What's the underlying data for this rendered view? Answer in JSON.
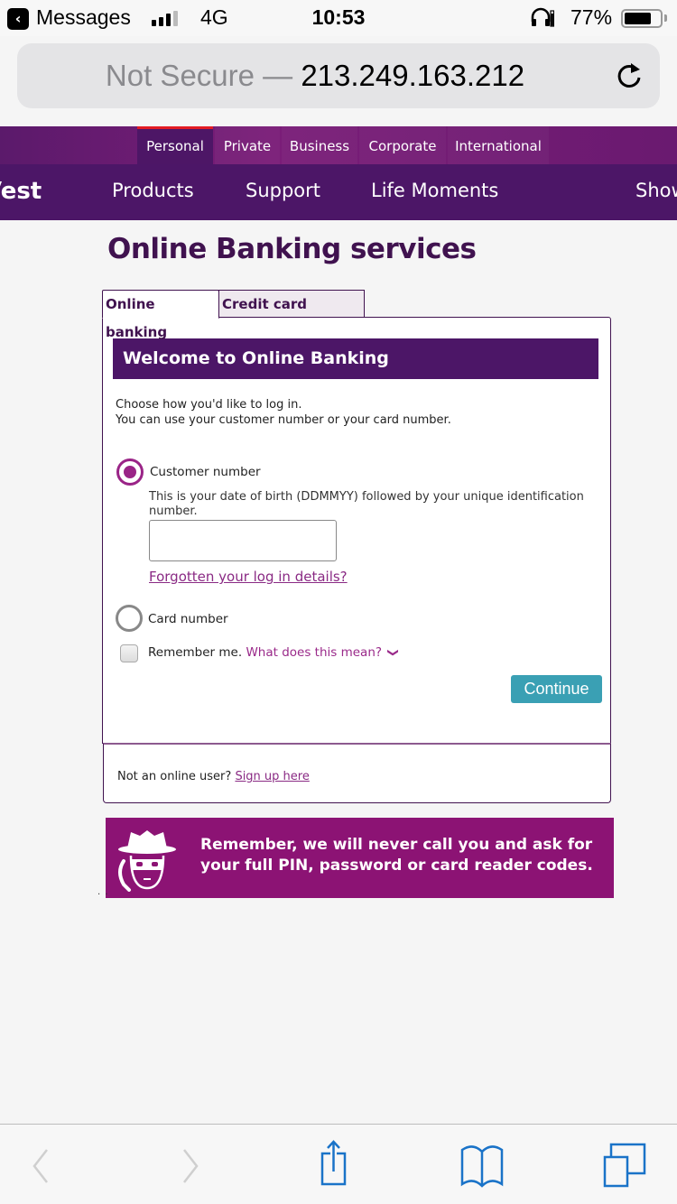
{
  "status_bar": {
    "back_app": "Messages",
    "network": "4G",
    "time": "10:53",
    "battery_percent": "77%",
    "battery_level": 0.77,
    "signal_bars_active": 3,
    "signal_bars_total": 4
  },
  "url_bar": {
    "security_label": "Not Secure —",
    "host": "213.249.163.212"
  },
  "site": {
    "brand_partial": "Vest",
    "top_nav": [
      {
        "label": "Personal",
        "active": true
      },
      {
        "label": "Private",
        "active": false
      },
      {
        "label": "Business",
        "active": false
      },
      {
        "label": "Corporate",
        "active": false
      },
      {
        "label": "International",
        "active": false
      }
    ],
    "main_nav": [
      {
        "label": "Products"
      },
      {
        "label": "Support"
      },
      {
        "label": "Life Moments"
      },
      {
        "label": "Show"
      }
    ]
  },
  "page": {
    "title": "Online Banking services",
    "tabs": [
      {
        "label": "Online banking",
        "active": true
      },
      {
        "label": "Credit card services",
        "active": false
      }
    ],
    "panel_heading": "Welcome to Online Banking",
    "intro_line1": "Choose how you'd like to log in.",
    "intro_line2": "You can use your customer number or your card number.",
    "options": {
      "customer_number": {
        "label": "Customer number",
        "selected": true,
        "help": "This is your date of birth (DDMMYY) followed by your unique identification number.",
        "input_value": "",
        "forgot_link": "Forgotten your log in details?"
      },
      "card_number": {
        "label": "Card number",
        "selected": false
      }
    },
    "remember_me": {
      "label": "Remember me.",
      "checked": false,
      "help_link": "What does this mean?",
      "chevron": "❯"
    },
    "continue_label": "Continue",
    "footer_text": "Not an online user?",
    "signup_link": "Sign up here",
    "banner_line1": "Remember, we will never call you and ask for",
    "banner_line2": "your full PIN, password or card reader codes.",
    "stray_dots": "· ·"
  },
  "colors": {
    "brand_purple": "#4c1667",
    "accent_magenta": "#9a2487",
    "banner_bg": "#8c1374",
    "button_teal": "#3aa0b4",
    "active_tab_marker": "#e31b23",
    "ios_blue": "#1a73c8"
  },
  "toolbar": {
    "back_enabled": false,
    "forward_enabled": false
  }
}
